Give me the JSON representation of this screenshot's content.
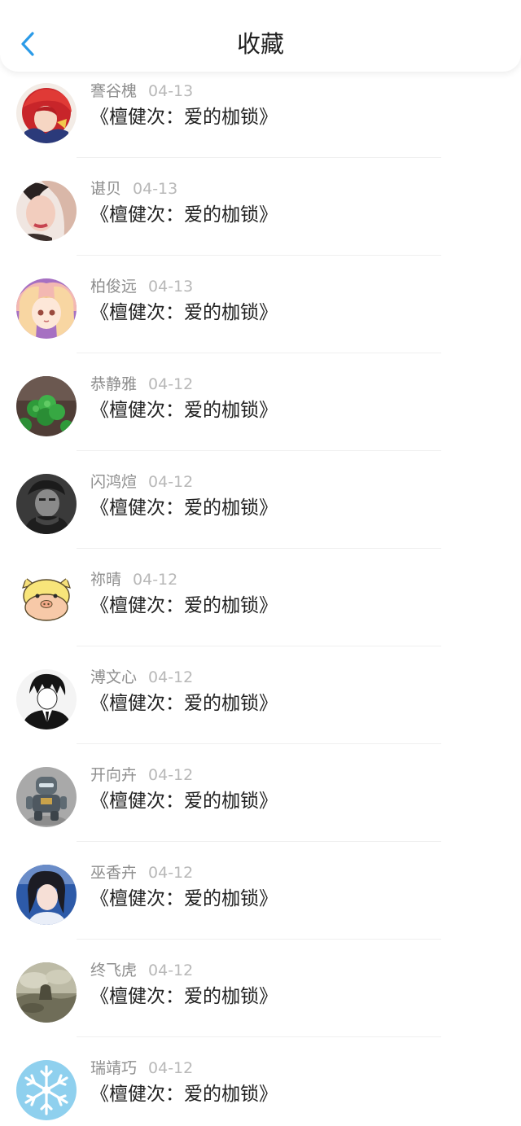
{
  "header": {
    "title": "收藏",
    "accent_color": "#2b9be8"
  },
  "items": [
    {
      "user": "謇谷槐",
      "date": "04-13",
      "title": "《檀健次：爱的枷锁》",
      "avatar": "anime-red-hair-avatar"
    },
    {
      "user": "谌贝",
      "date": "04-13",
      "title": "《檀健次：爱的枷锁》",
      "avatar": "woman-photo-avatar"
    },
    {
      "user": "柏俊远",
      "date": "04-13",
      "title": "《檀健次：爱的枷锁》",
      "avatar": "anime-girl-avatar"
    },
    {
      "user": "恭静雅",
      "date": "04-12",
      "title": "《檀健次：爱的枷锁》",
      "avatar": "clover-leaf-avatar"
    },
    {
      "user": "闪鸿煊",
      "date": "04-12",
      "title": "《檀健次：爱的枷锁》",
      "avatar": "dark-portrait-avatar"
    },
    {
      "user": "祢晴",
      "date": "04-12",
      "title": "《檀健次：爱的枷锁》",
      "avatar": "pig-cartoon-avatar"
    },
    {
      "user": "溥文心",
      "date": "04-12",
      "title": "《檀健次：爱的枷锁》",
      "avatar": "manga-suit-avatar"
    },
    {
      "user": "开向卉",
      "date": "04-12",
      "title": "《檀健次：爱的枷锁》",
      "avatar": "robot-figure-avatar"
    },
    {
      "user": "巫香卉",
      "date": "04-12",
      "title": "《檀健次：爱的枷锁》",
      "avatar": "girl-photo-avatar"
    },
    {
      "user": "终飞虎",
      "date": "04-12",
      "title": "《檀健次：爱的枷锁》",
      "avatar": "cloudy-landscape-avatar"
    },
    {
      "user": "瑞靖巧",
      "date": "04-12",
      "title": "《檀健次：爱的枷锁》",
      "avatar": "snowflake-avatar"
    }
  ]
}
